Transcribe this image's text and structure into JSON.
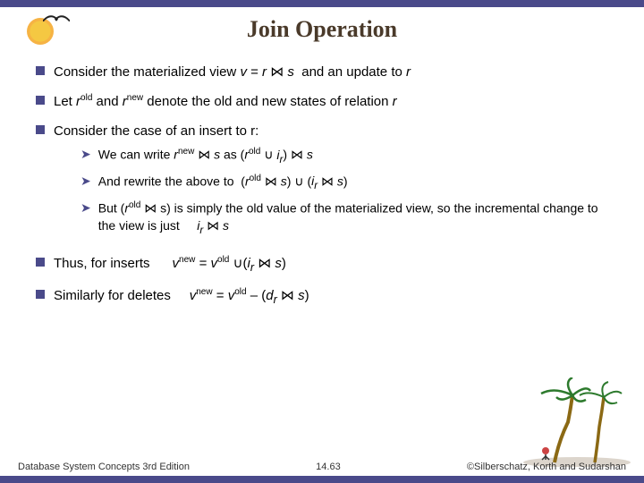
{
  "slide": {
    "title": "Join Operation",
    "bullets": [
      {
        "id": "bullet1",
        "text": "Consider the materialized view v = r ⋈ s  and an update to r"
      },
      {
        "id": "bullet2",
        "text": "Let r",
        "superOld": "old",
        "textMid": " and r",
        "superNew": "new",
        "textEnd": " denote the old and new states of relation r"
      },
      {
        "id": "bullet3",
        "text": "Consider the case of an insert to r:",
        "subBullets": [
          {
            "text": "We can write r",
            "sup": "new",
            "textMid": " ⋈ s as (r",
            "sup2": "old",
            "textEnd": " ∪ i",
            "sub": "r",
            "textFinal": ") ⋈ s"
          },
          {
            "text": "And rewrite the above to  (r",
            "sup": "old",
            "textMid": " ⋈ s) ∪ (i",
            "sub": "r",
            "textEnd": " ⋈ s)"
          },
          {
            "text": "But (r",
            "sup": "old",
            "textMid": " ⋈ s) is simply the old value of the materialized view, so the incremental change to the view is just",
            "textEnd": "    i",
            "sub": "r",
            "textFinal": " ⋈ s"
          }
        ]
      },
      {
        "id": "bullet4",
        "text": "Thus, for inserts",
        "formula": "v",
        "formulaSup": "new",
        "formulaText": " = v",
        "formulaSup2": "old",
        "formulaEnd": " ∪(i",
        "formulaSub": "r",
        "formulaFinal": " ⋈ s)"
      },
      {
        "id": "bullet5",
        "text": "Similarly for deletes",
        "formula": "v",
        "formulaSup": "new",
        "formulaText": " = v",
        "formulaSup2": "old",
        "formulaEnd": " – (d",
        "formulaSub": "r",
        "formulaFinal": " ⋈ s)"
      }
    ],
    "footer": {
      "left": "Database System Concepts 3rd Edition",
      "center": "14.63",
      "right": "©Silberschatz, Korth and Sudarshan"
    }
  }
}
